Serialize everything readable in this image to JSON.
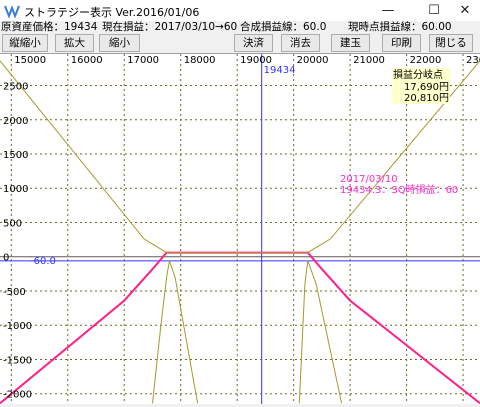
{
  "window": {
    "title": "ストラテジー表示 Ver.2016/01/06",
    "minimize": "—",
    "maximize": "☐",
    "close": "✕"
  },
  "info": {
    "underlying_price": "原資産価格：19434",
    "current_pnl": "現在損益：2017/03/10→60",
    "total_pnl_line": "合成損益線：60.0",
    "current_pnl_line": "現時点損益線：60.00"
  },
  "toolbar": {
    "vertical_shrink": "縦縮小",
    "expand": "拡大",
    "shrink": "縮小",
    "settle": "決済",
    "delete": "消去",
    "position": "建玉",
    "print": "印刷",
    "close": "閉じる"
  },
  "colors": {
    "payoff_line": "#ff1f8a",
    "current_line": "#a59a2a",
    "grid": "#6a6a2a",
    "marker": "#3333ff",
    "annotation": "#ff2ad4",
    "zero_line": "#5a5a5a",
    "breakeven_bg": "#ffffcc"
  },
  "chart_data": {
    "type": "line",
    "xlim": [
      14800,
      23300
    ],
    "ylim": [
      -2150,
      2960
    ],
    "x_ticks": [
      "15000",
      "16000",
      "17000",
      "18000",
      "19000",
      "20000",
      "21000",
      "22000",
      "23000"
    ],
    "y_ticks": [
      "2500",
      "2000",
      "1500",
      "1000",
      "500",
      "0",
      "-500",
      "-1000",
      "-1500",
      "-2000"
    ],
    "current_price": 19434,
    "current_price_label": "19434",
    "pnl_value_label": "-60.0",
    "pnl_value": -60,
    "breakeven": {
      "title": "損益分岐点",
      "values": [
        "17,690円",
        "20,810円"
      ]
    },
    "annotation": {
      "line1": "2017/03/10",
      "line2": "19434.3：SQ時損益：60"
    },
    "series": [
      {
        "x": [
          14800,
          17000,
          17500,
          17750,
          20250,
          20500,
          21000,
          23300
        ],
        "y": [
          -2140,
          -640,
          -180,
          60,
          60,
          -180,
          -640,
          -2140
        ]
      },
      {
        "x": [
          14800,
          17350,
          17750,
          20250,
          20650,
          23300
        ],
        "y": [
          2860,
          260,
          60,
          60,
          260,
          2860
        ]
      },
      {
        "x": [
          17500,
          17650,
          17750,
          17800,
          17900,
          18300
        ],
        "y": [
          -2140,
          -1000,
          -300,
          -60,
          -300,
          -2140
        ]
      },
      {
        "x": [
          20100,
          20200,
          20250,
          20400,
          20850
        ],
        "y": [
          -2140,
          -400,
          -60,
          -400,
          -2140
        ]
      }
    ]
  }
}
